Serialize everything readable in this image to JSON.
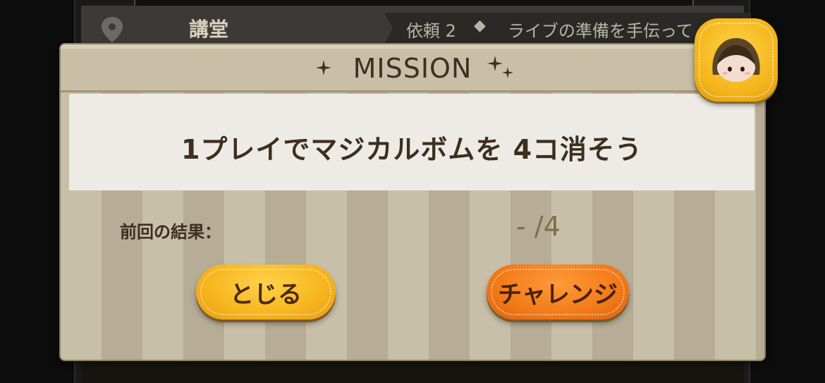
{
  "background": {
    "location_title": "講堂",
    "request_label": "依頼 2",
    "request_separator": "◆",
    "request_text": "ライブの準備を手伝って"
  },
  "dialog": {
    "title": "MISSION",
    "mission_text": "1プレイでマジカルボムを 4コ消そう",
    "result_label": "前回の結果：",
    "result_value": "- /4",
    "close_label": "とじる",
    "challenge_label": "チャレンジ"
  },
  "icons": {
    "location": "map-pin-icon",
    "sparkle_left": "sparkle-icon",
    "sparkle_right": "sparkles-icon",
    "avatar": "tsum-character-avatar"
  },
  "colors": {
    "close_button": "#f7b51d",
    "challenge_button": "#f27a18",
    "dialog_bg": "#bdb29a"
  }
}
